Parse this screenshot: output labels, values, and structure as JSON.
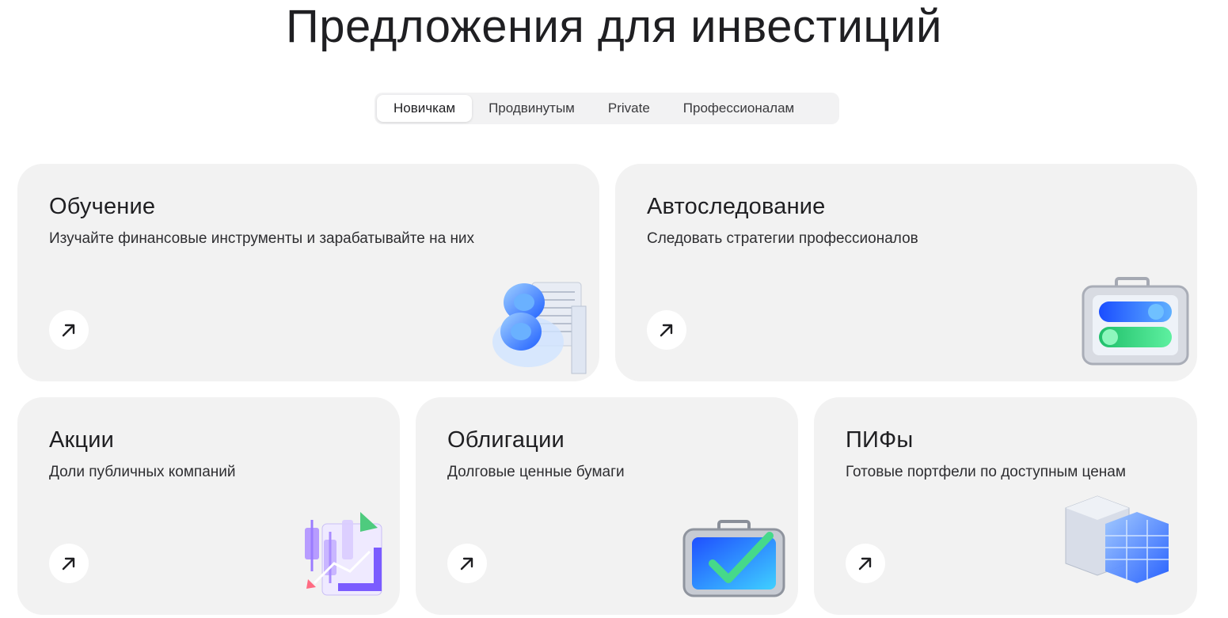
{
  "page": {
    "title": "Предложения для инвестиций"
  },
  "tabs": [
    {
      "label": "Новичкам",
      "active": true
    },
    {
      "label": "Продвинутым",
      "active": false
    },
    {
      "label": "Private",
      "active": false
    },
    {
      "label": "Профессионалам",
      "active": false
    }
  ],
  "cards": [
    {
      "title": "Обучение",
      "subtitle": "Изучайте финансовые инструменты и зарабатывайте на них",
      "icon": "education-illustration"
    },
    {
      "title": "Автоследование",
      "subtitle": "Следовать стратегии профессионалов",
      "icon": "toggle-case-illustration"
    },
    {
      "title": "Акции",
      "subtitle": "Доли публичных компаний",
      "icon": "candlestick-chart-illustration"
    },
    {
      "title": "Облигации",
      "subtitle": "Долговые ценные бумаги",
      "icon": "briefcase-check-illustration"
    },
    {
      "title": "ПИФы",
      "subtitle": "Готовые портфели по доступным ценам",
      "icon": "cubes-portfolio-illustration"
    }
  ],
  "colors": {
    "card_bg": "#f2f2f2",
    "text": "#1f1f22",
    "accent_blue": "#2f6bff",
    "accent_green": "#2fd27a",
    "accent_purple": "#7b5cff"
  }
}
